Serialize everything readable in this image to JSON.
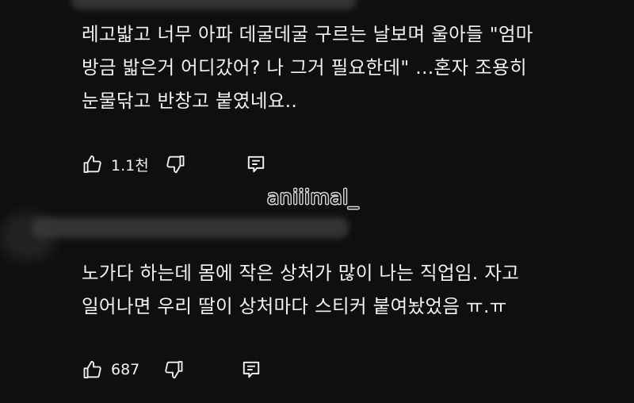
{
  "watermark": "aniiimal_",
  "comments": [
    {
      "lines": [
        "레고밟고 너무 아파 데굴데굴 구르는 날보며 울아들 \"엄마",
        "방금 밟은거 어디갔어? 나 그거 필요한데\" ...혼자 조용히",
        "눈물닦고 반창고 붙였네요.."
      ],
      "like_count": "1.1천"
    },
    {
      "lines": [
        "노가다 하는데 몸에 작은 상처가 많이 나는 직업임. 자고",
        "일어나면 우리 딸이 상처마다 스티커 붙여놨었음 ㅠ.ㅠ"
      ],
      "like_count": "687"
    }
  ],
  "icons": {
    "like": "thumbs-up-icon",
    "dislike": "thumbs-down-icon",
    "reply": "reply-comment-icon"
  }
}
